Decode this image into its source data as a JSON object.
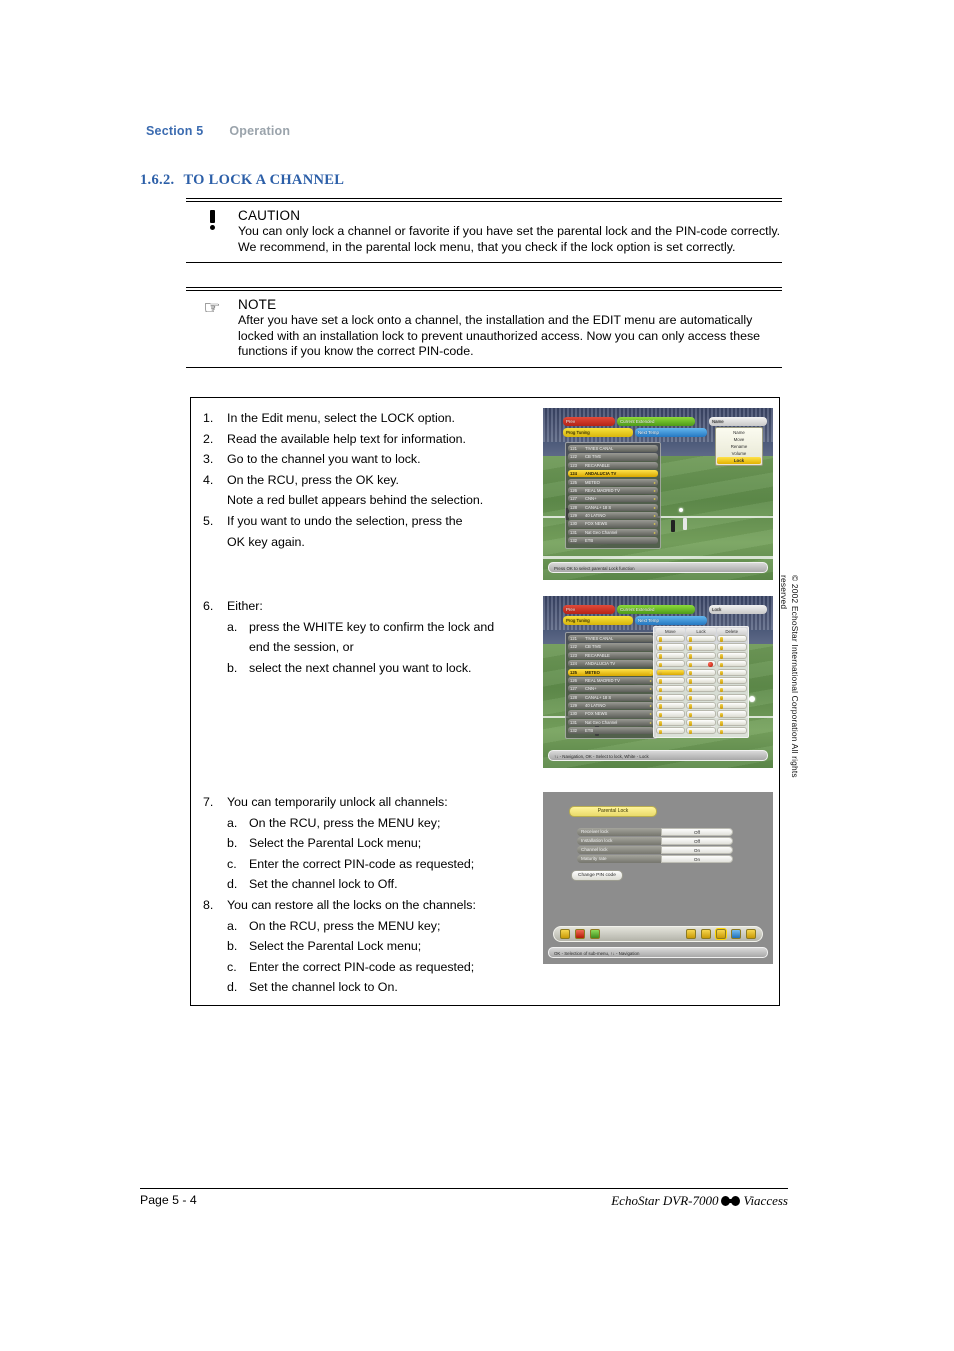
{
  "running_head": {
    "section": "Section 5",
    "chapter": "Operation"
  },
  "section": {
    "number": "1.6.2.",
    "title": "TO LOCK A CHANNEL"
  },
  "caution": {
    "icon": "exclamation-icon",
    "title": "CAUTION",
    "body": "You can only lock a channel or favorite if you have set the parental lock and the PIN-code correctly. We recommend, in the parental lock menu, that you check if the lock option is set correctly."
  },
  "note": {
    "icon": "pointing-hand-icon",
    "title": "NOTE",
    "body": "After you have set a lock onto a channel, the installation and the EDIT menu are automatically locked with an installation lock to prevent unauthorized access. Now you can only access these functions if you know the correct PIN-code."
  },
  "steps": [
    {
      "num": "1.",
      "text": "In the Edit menu, select the LOCK option."
    },
    {
      "num": "2.",
      "text": "Read the available help text for information."
    },
    {
      "num": "3.",
      "text": "Go to the channel you want to lock."
    },
    {
      "num": "4.",
      "text": "On the RCU, press the OK key.",
      "cont": "Note a red bullet appears behind the selection."
    },
    {
      "num": "5.",
      "text": "If you want to undo the selection, press the",
      "cont": "OK key again."
    },
    {
      "num": "6.",
      "text": "Either:",
      "sub": [
        {
          "mk": "a.",
          "text": "press the WHITE key to confirm the lock and",
          "cont": "end the session, or"
        },
        {
          "mk": "b.",
          "text": "select the next channel you want to lock."
        }
      ]
    },
    {
      "num": "7.",
      "text": "You can temporarily unlock all channels:",
      "sub": [
        {
          "mk": "a.",
          "text": "On the RCU, press the MENU key;"
        },
        {
          "mk": "b.",
          "text": "Select the Parental Lock menu;"
        },
        {
          "mk": "c.",
          "text": "Enter the correct PIN-code as requested;"
        },
        {
          "mk": "d.",
          "text": "Set the channel lock to Off."
        }
      ]
    },
    {
      "num": "8.",
      "text": "You can restore all the locks on the channels:",
      "sub": [
        {
          "mk": "a.",
          "text": "On the RCU, press the MENU key;"
        },
        {
          "mk": "b.",
          "text": "Select the Parental Lock menu;"
        },
        {
          "mk": "c.",
          "text": "Enter the correct PIN-code as requested;"
        },
        {
          "mk": "d.",
          "text": "Set the channel lock to On."
        }
      ]
    }
  ],
  "screenshot_1": {
    "caption_role": "edit-menu-lock-selection",
    "bars": [
      {
        "color": "red",
        "label": "Prev"
      },
      {
        "color": "green",
        "label": "Current Extended"
      },
      {
        "color": "yellow",
        "label": "Prog Tuning"
      },
      {
        "color": "blue",
        "label": "Next Temp"
      }
    ],
    "dropdown": {
      "header": "Name",
      "items": [
        "Name",
        "Move",
        "Rename",
        "Volume",
        "Lock"
      ],
      "selected": "Lock"
    },
    "channels": [
      {
        "num": "121",
        "name": "TIVIES CANAL"
      },
      {
        "num": "122",
        "name": "CB TIVE"
      },
      {
        "num": "123",
        "name": "RECAPABLE"
      },
      {
        "num": "124",
        "name": "ANDALUCIA TV",
        "selected": true
      },
      {
        "num": "125",
        "name": "METEO"
      },
      {
        "num": "126",
        "name": "REAL MADRID TV"
      },
      {
        "num": "127",
        "name": "CNN+"
      },
      {
        "num": "128",
        "name": "CANAL+ 18 S"
      },
      {
        "num": "129",
        "name": "40 LATINO"
      },
      {
        "num": "130",
        "name": "FOX NEWS"
      },
      {
        "num": "131",
        "name": "Nat Geo Channel"
      },
      {
        "num": "132",
        "name": "ETB"
      }
    ],
    "statusbar": "Press OK to select parental Lock function"
  },
  "screenshot_2": {
    "caption_role": "lock-column-edit",
    "bars": [
      {
        "color": "red",
        "label": "Prev"
      },
      {
        "color": "green",
        "label": "Current Extended"
      },
      {
        "color": "yellow",
        "label": "Prog Tuning"
      },
      {
        "color": "blue",
        "label": "Next Temp"
      }
    ],
    "mode_badge": "Lock",
    "columns": [
      "Move",
      "Lock",
      "Delete"
    ],
    "channels": [
      {
        "num": "121",
        "name": "TIVIES CANAL"
      },
      {
        "num": "122",
        "name": "CB TIVE"
      },
      {
        "num": "123",
        "name": "RECAPABLE"
      },
      {
        "num": "124",
        "name": "ANDALUCIA TV",
        "locked": true
      },
      {
        "num": "125",
        "name": "METEO",
        "selected": true
      },
      {
        "num": "126",
        "name": "REAL MADRID TV"
      },
      {
        "num": "127",
        "name": "CNN+"
      },
      {
        "num": "128",
        "name": "CANAL+ 18 S"
      },
      {
        "num": "129",
        "name": "40 LATINO"
      },
      {
        "num": "130",
        "name": "FOX NEWS"
      },
      {
        "num": "131",
        "name": "Nat Geo Channel"
      },
      {
        "num": "132",
        "name": "ETB"
      }
    ],
    "statusbar": "↑↓ - Navigation, OK - Select to lock, White - Lock"
  },
  "screenshot_3": {
    "caption_role": "parental-lock-menu",
    "title": "Parental Lock",
    "rows": [
      {
        "label": "Receiver lock",
        "value": "Off"
      },
      {
        "label": "Installation lock",
        "value": "Off"
      },
      {
        "label": "Channel lock",
        "value": "On"
      },
      {
        "label": "Maturity rate",
        "value": "On"
      }
    ],
    "button": "Change PIN code",
    "statusbar": "OK - Selection of sub-menu, ↑↓ - Navigation"
  },
  "copyright": "© 2002 EchoStar International Corporation  All rights reserved",
  "footer": {
    "left": "Page 5 - 4",
    "right_pre": "EchoStar DVR-7000",
    "logo": "dolby-digital-logo",
    "right_post": "Viaccess"
  }
}
